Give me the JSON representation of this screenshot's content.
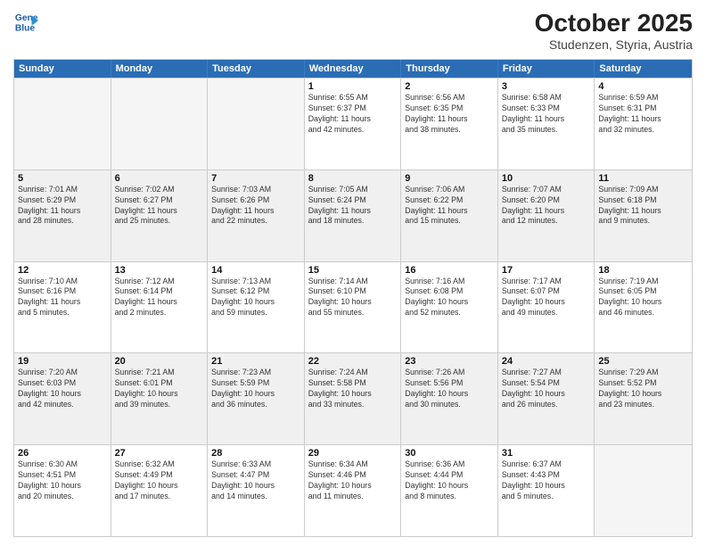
{
  "logo": {
    "line1": "General",
    "line2": "Blue"
  },
  "title": "October 2025",
  "subtitle": "Studenzen, Styria, Austria",
  "header_days": [
    "Sunday",
    "Monday",
    "Tuesday",
    "Wednesday",
    "Thursday",
    "Friday",
    "Saturday"
  ],
  "rows": [
    [
      {
        "day": "",
        "info": "",
        "empty": true
      },
      {
        "day": "",
        "info": "",
        "empty": true
      },
      {
        "day": "",
        "info": "",
        "empty": true
      },
      {
        "day": "1",
        "info": "Sunrise: 6:55 AM\nSunset: 6:37 PM\nDaylight: 11 hours\nand 42 minutes."
      },
      {
        "day": "2",
        "info": "Sunrise: 6:56 AM\nSunset: 6:35 PM\nDaylight: 11 hours\nand 38 minutes."
      },
      {
        "day": "3",
        "info": "Sunrise: 6:58 AM\nSunset: 6:33 PM\nDaylight: 11 hours\nand 35 minutes."
      },
      {
        "day": "4",
        "info": "Sunrise: 6:59 AM\nSunset: 6:31 PM\nDaylight: 11 hours\nand 32 minutes."
      }
    ],
    [
      {
        "day": "5",
        "info": "Sunrise: 7:01 AM\nSunset: 6:29 PM\nDaylight: 11 hours\nand 28 minutes."
      },
      {
        "day": "6",
        "info": "Sunrise: 7:02 AM\nSunset: 6:27 PM\nDaylight: 11 hours\nand 25 minutes."
      },
      {
        "day": "7",
        "info": "Sunrise: 7:03 AM\nSunset: 6:26 PM\nDaylight: 11 hours\nand 22 minutes."
      },
      {
        "day": "8",
        "info": "Sunrise: 7:05 AM\nSunset: 6:24 PM\nDaylight: 11 hours\nand 18 minutes."
      },
      {
        "day": "9",
        "info": "Sunrise: 7:06 AM\nSunset: 6:22 PM\nDaylight: 11 hours\nand 15 minutes."
      },
      {
        "day": "10",
        "info": "Sunrise: 7:07 AM\nSunset: 6:20 PM\nDaylight: 11 hours\nand 12 minutes."
      },
      {
        "day": "11",
        "info": "Sunrise: 7:09 AM\nSunset: 6:18 PM\nDaylight: 11 hours\nand 9 minutes."
      }
    ],
    [
      {
        "day": "12",
        "info": "Sunrise: 7:10 AM\nSunset: 6:16 PM\nDaylight: 11 hours\nand 5 minutes."
      },
      {
        "day": "13",
        "info": "Sunrise: 7:12 AM\nSunset: 6:14 PM\nDaylight: 11 hours\nand 2 minutes."
      },
      {
        "day": "14",
        "info": "Sunrise: 7:13 AM\nSunset: 6:12 PM\nDaylight: 10 hours\nand 59 minutes."
      },
      {
        "day": "15",
        "info": "Sunrise: 7:14 AM\nSunset: 6:10 PM\nDaylight: 10 hours\nand 55 minutes."
      },
      {
        "day": "16",
        "info": "Sunrise: 7:16 AM\nSunset: 6:08 PM\nDaylight: 10 hours\nand 52 minutes."
      },
      {
        "day": "17",
        "info": "Sunrise: 7:17 AM\nSunset: 6:07 PM\nDaylight: 10 hours\nand 49 minutes."
      },
      {
        "day": "18",
        "info": "Sunrise: 7:19 AM\nSunset: 6:05 PM\nDaylight: 10 hours\nand 46 minutes."
      }
    ],
    [
      {
        "day": "19",
        "info": "Sunrise: 7:20 AM\nSunset: 6:03 PM\nDaylight: 10 hours\nand 42 minutes."
      },
      {
        "day": "20",
        "info": "Sunrise: 7:21 AM\nSunset: 6:01 PM\nDaylight: 10 hours\nand 39 minutes."
      },
      {
        "day": "21",
        "info": "Sunrise: 7:23 AM\nSunset: 5:59 PM\nDaylight: 10 hours\nand 36 minutes."
      },
      {
        "day": "22",
        "info": "Sunrise: 7:24 AM\nSunset: 5:58 PM\nDaylight: 10 hours\nand 33 minutes."
      },
      {
        "day": "23",
        "info": "Sunrise: 7:26 AM\nSunset: 5:56 PM\nDaylight: 10 hours\nand 30 minutes."
      },
      {
        "day": "24",
        "info": "Sunrise: 7:27 AM\nSunset: 5:54 PM\nDaylight: 10 hours\nand 26 minutes."
      },
      {
        "day": "25",
        "info": "Sunrise: 7:29 AM\nSunset: 5:52 PM\nDaylight: 10 hours\nand 23 minutes."
      }
    ],
    [
      {
        "day": "26",
        "info": "Sunrise: 6:30 AM\nSunset: 4:51 PM\nDaylight: 10 hours\nand 20 minutes."
      },
      {
        "day": "27",
        "info": "Sunrise: 6:32 AM\nSunset: 4:49 PM\nDaylight: 10 hours\nand 17 minutes."
      },
      {
        "day": "28",
        "info": "Sunrise: 6:33 AM\nSunset: 4:47 PM\nDaylight: 10 hours\nand 14 minutes."
      },
      {
        "day": "29",
        "info": "Sunrise: 6:34 AM\nSunset: 4:46 PM\nDaylight: 10 hours\nand 11 minutes."
      },
      {
        "day": "30",
        "info": "Sunrise: 6:36 AM\nSunset: 4:44 PM\nDaylight: 10 hours\nand 8 minutes."
      },
      {
        "day": "31",
        "info": "Sunrise: 6:37 AM\nSunset: 4:43 PM\nDaylight: 10 hours\nand 5 minutes."
      },
      {
        "day": "",
        "info": "",
        "empty": true
      }
    ]
  ]
}
